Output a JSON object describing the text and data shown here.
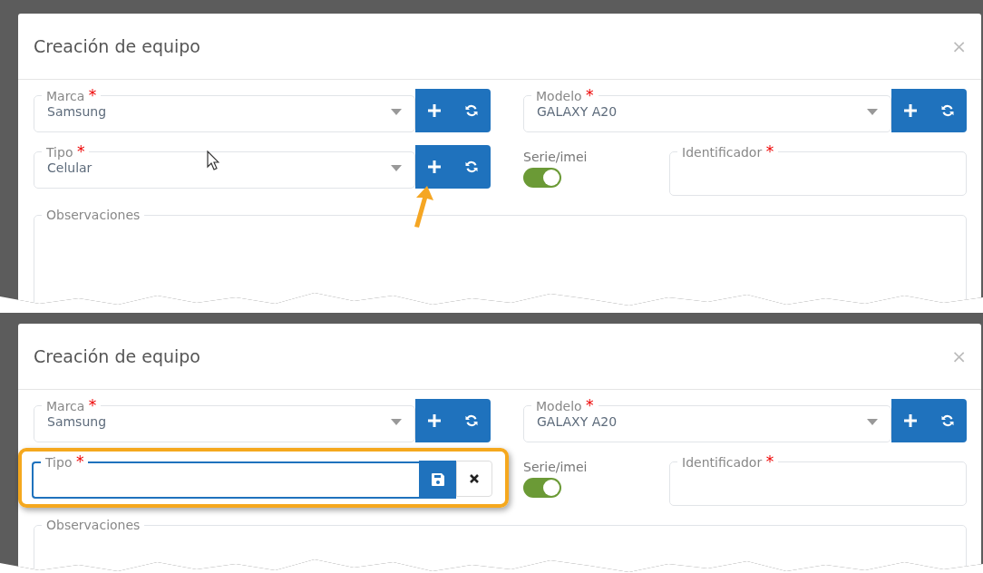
{
  "panels": [
    {
      "title": "Creación de equipo",
      "close": "×",
      "cursor": true,
      "marca": {
        "label": "Marca",
        "required_mark": "*",
        "value": "Samsung"
      },
      "modelo": {
        "label": "Modelo",
        "required_mark": "*",
        "value": "GALAXY A20"
      },
      "tipo": {
        "label": "Tipo",
        "required_mark": "*",
        "kind": "select",
        "value": "Celular",
        "pointer_arrow": true
      },
      "serie": {
        "label": "Serie/imei",
        "on": true
      },
      "identificador": {
        "label": "Identificador",
        "required_mark": "*"
      },
      "observaciones": {
        "label": "Observaciones"
      }
    },
    {
      "title": "Creación de equipo",
      "close": "×",
      "cursor": false,
      "marca": {
        "label": "Marca",
        "required_mark": "*",
        "value": "Samsung"
      },
      "modelo": {
        "label": "Modelo",
        "required_mark": "*",
        "value": "GALAXY A20"
      },
      "tipo": {
        "label": "Tipo",
        "required_mark": "*",
        "kind": "edit",
        "highlighted": true
      },
      "serie": {
        "label": "Serie/imei",
        "on": true
      },
      "identificador": {
        "label": "Identificador",
        "required_mark": "*"
      },
      "observaciones": {
        "label": "Observaciones"
      }
    }
  ]
}
